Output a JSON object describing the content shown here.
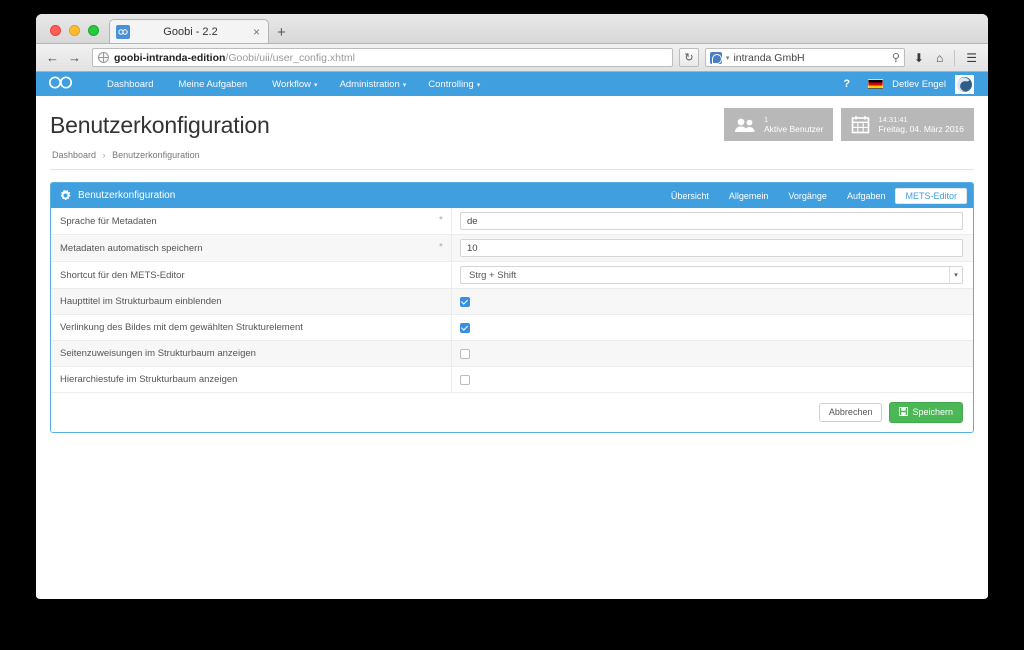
{
  "browser": {
    "tab": {
      "title": "Goobi - 2.2",
      "favicon": "goobi-favicon",
      "close": "×"
    },
    "new_tab": "+",
    "back": "←",
    "forward": "→",
    "url_domain": "goobi-intranda-edition",
    "url_path": "/Goobi/uii/user_config.xhtml",
    "reload": "↻",
    "search_value": "intranda GmbH",
    "search_caret": "▾",
    "search_icon": "⚲",
    "download_icon": "⬇",
    "home_icon": "⌂",
    "menu_icon": "☰"
  },
  "appnav": {
    "brand": "∞",
    "items": [
      {
        "label": "Dashboard",
        "caret": ""
      },
      {
        "label": "Meine Aufgaben",
        "caret": ""
      },
      {
        "label": "Workflow",
        "caret": "▾"
      },
      {
        "label": "Administration",
        "caret": "▾"
      },
      {
        "label": "Controlling",
        "caret": "▾"
      }
    ],
    "help": "?",
    "language_flag": "de",
    "user_name": "Detlev Engel"
  },
  "page": {
    "title": "Benutzerkonfiguration",
    "breadcrumb": {
      "root": "Dashboard",
      "separator": "›",
      "current": "Benutzerkonfiguration"
    },
    "info_boxes": [
      {
        "icon": "users-icon",
        "top": "1",
        "bottom": "Aktive Benutzer"
      },
      {
        "icon": "calendar-icon",
        "top": "14:31:41",
        "bottom": "Freitag, 04. März 2016"
      }
    ]
  },
  "panel": {
    "icon": "gear-icon",
    "title": "Benutzerkonfiguration",
    "tabs": [
      {
        "label": "Übersicht",
        "active": false
      },
      {
        "label": "Allgemein",
        "active": false
      },
      {
        "label": "Vorgänge",
        "active": false
      },
      {
        "label": "Aufgaben",
        "active": false
      },
      {
        "label": "METS-Editor",
        "active": true
      }
    ],
    "rows": [
      {
        "label": "Sprache für Metadaten",
        "required": "*",
        "type": "text",
        "value": "de"
      },
      {
        "label": "Metadaten automatisch speichern",
        "required": "*",
        "type": "text",
        "value": "10"
      },
      {
        "label": "Shortcut für den METS-Editor",
        "required": "",
        "type": "select",
        "value": "Strg + Shift",
        "arrow": "▾"
      },
      {
        "label": "Haupttitel im Strukturbaum einblenden",
        "required": "",
        "type": "checkbox",
        "checked": true
      },
      {
        "label": "Verlinkung des Bildes mit dem gewählten Strukturelement",
        "required": "",
        "type": "checkbox",
        "checked": true
      },
      {
        "label": "Seitenzuweisungen im Strukturbaum anzeigen",
        "required": "",
        "type": "checkbox",
        "checked": false
      },
      {
        "label": "Hierarchiestufe im Strukturbaum anzeigen",
        "required": "",
        "type": "checkbox",
        "checked": false
      }
    ],
    "cancel_label": "Abbrechen",
    "save_label": "Speichern",
    "save_icon": "save-icon"
  },
  "colors": {
    "brand_blue": "#3f9fdf",
    "success_green": "#4cb757",
    "info_gray": "#b8b8b8",
    "checkbox_blue": "#3b8fe0"
  }
}
